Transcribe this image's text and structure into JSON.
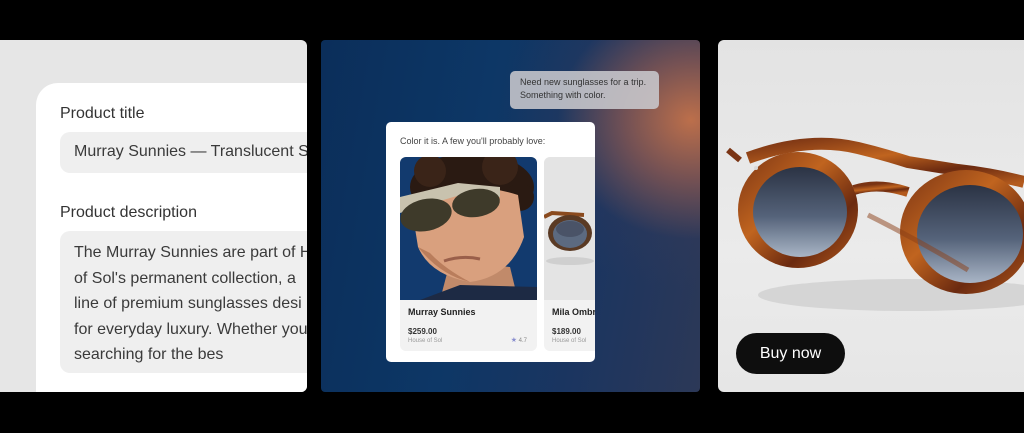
{
  "product_form": {
    "title_label": "Product title",
    "title_value": "Murray Sunnies — Translucent S",
    "description_label": "Product description",
    "description_lines": [
      "The Murray Sunnies are part of H",
      "of Sol's permanent collection, a",
      "line of premium sunglasses desi",
      "for everyday luxury. Whether you",
      "searching for the bes"
    ]
  },
  "chat": {
    "user_message_lines": [
      "Need new sunglasses for a trip.",
      "Something with color."
    ],
    "assistant_message": "Color it is. A few you'll probably love:",
    "products": [
      {
        "name": "Murray Sunnies",
        "price": "$259.00",
        "brand": "House of Sol",
        "rating": "4.7",
        "icon": "star-icon"
      },
      {
        "name": "Mila Ombre",
        "price": "$189.00",
        "brand": "House of Sol"
      }
    ]
  },
  "hero": {
    "buy_label": "Buy now",
    "image": "tortoiseshell-sunglasses"
  },
  "colors": {
    "background": "#000000",
    "button": "#0e0e0e",
    "rating_star": "#8a8fcf"
  }
}
